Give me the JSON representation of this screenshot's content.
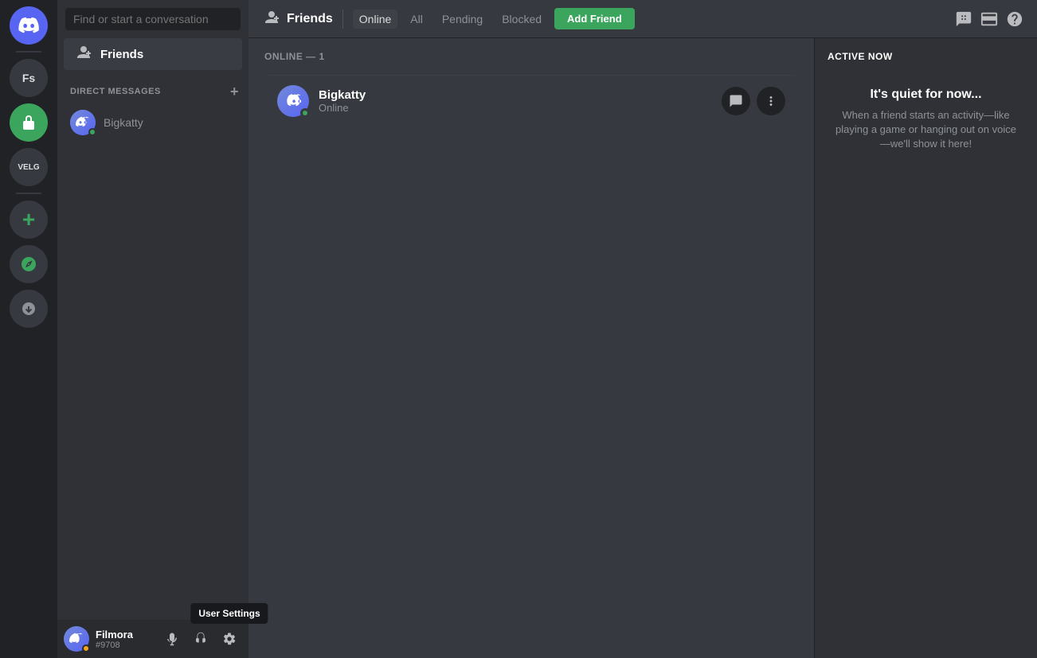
{
  "app": {
    "title": "Discord"
  },
  "server_sidebar": {
    "icons": [
      {
        "id": "discord-home",
        "type": "discord",
        "label": "Home"
      },
      {
        "id": "fs-server",
        "type": "text",
        "text": "Fs",
        "label": "Fs Server"
      },
      {
        "id": "plugin-server",
        "type": "plugin",
        "label": "Plugin Server"
      },
      {
        "id": "velg-server",
        "type": "text",
        "text": "VELG",
        "label": "VELG Server"
      },
      {
        "id": "add-server",
        "type": "add",
        "label": "Add a Server"
      },
      {
        "id": "explore-server",
        "type": "explore",
        "label": "Explore Public Servers"
      },
      {
        "id": "download",
        "type": "download",
        "label": "Download Apps"
      }
    ]
  },
  "dm_sidebar": {
    "search_placeholder": "Find or start a conversation",
    "friends_label": "Friends",
    "direct_messages_label": "Direct Messages",
    "dm_list": [
      {
        "name": "Bigkatty",
        "status": "online"
      }
    ]
  },
  "user_panel": {
    "username": "Filmora",
    "discriminator": "#9708",
    "status": "idle",
    "controls": {
      "mute_label": "Mute",
      "deafen_label": "Deafen",
      "settings_label": "User Settings"
    },
    "tooltip": "User Settings"
  },
  "top_nav": {
    "friends_label": "Friends",
    "tabs": [
      {
        "id": "online",
        "label": "Online",
        "active": true
      },
      {
        "id": "all",
        "label": "All",
        "active": false
      },
      {
        "id": "pending",
        "label": "Pending",
        "active": false
      },
      {
        "id": "blocked",
        "label": "Blocked",
        "active": false
      }
    ],
    "add_friend_label": "Add Friend"
  },
  "friends_list": {
    "online_header": "Online — 1",
    "friends": [
      {
        "name": "Bigkatty",
        "status": "Online"
      }
    ]
  },
  "active_now": {
    "title": "Active Now",
    "quiet_title": "It's quiet for now...",
    "quiet_description": "When a friend starts an activity—like playing a game or hanging out on voice—we'll show it here!"
  }
}
